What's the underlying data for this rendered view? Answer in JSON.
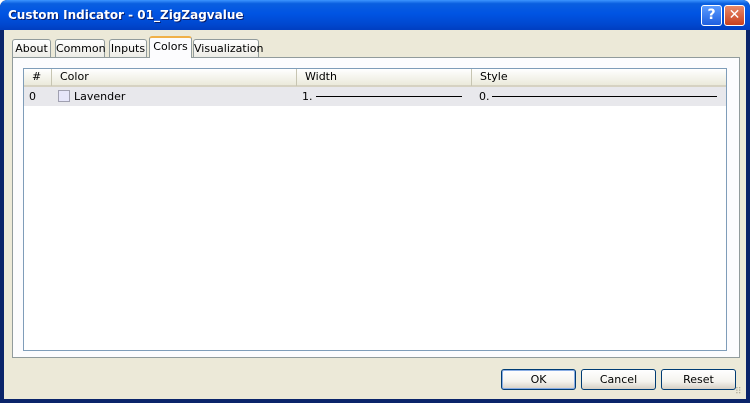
{
  "window": {
    "title": "Custom Indicator - 01_ZigZagvalue",
    "help_label": "?",
    "close_label": "✕"
  },
  "tabs": [
    {
      "label": "About"
    },
    {
      "label": "Common"
    },
    {
      "label": "Inputs"
    },
    {
      "label": "Colors",
      "active": true
    },
    {
      "label": "Visualization"
    }
  ],
  "table": {
    "headers": [
      "#",
      "Color",
      "Width",
      "Style"
    ],
    "rows": [
      {
        "index": "0",
        "color_name": "Lavender",
        "color_hex": "#e6e6fa",
        "width": "1.",
        "style": "0."
      }
    ]
  },
  "buttons": {
    "ok": "OK",
    "cancel": "Cancel",
    "reset": "Reset"
  }
}
